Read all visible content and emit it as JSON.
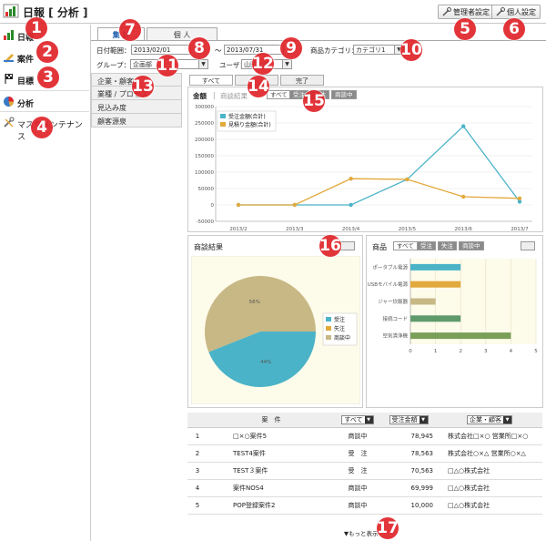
{
  "header": {
    "title": "日報 [ 分析 ]",
    "admin_label": "管理者設定",
    "personal_label": "個人設定"
  },
  "sidebar": {
    "items": [
      {
        "label": "日報"
      },
      {
        "label": "案件"
      },
      {
        "label": "目標"
      },
      {
        "label": "分析"
      },
      {
        "label": "マスタメンテナンス"
      }
    ]
  },
  "tabs": {
    "summary": "集 計",
    "personal": "個 人"
  },
  "filters": {
    "date_label": "日付範囲：",
    "date_from": "2013/02/01",
    "date_sep": "～",
    "date_to": "2013/07/31",
    "category_label": "商品カテゴリ：",
    "category_value": "カテゴリ1",
    "group_label": "グループ：",
    "group_value": "企画部",
    "user_label": "ユーザ：",
    "user_value": "山田太郎"
  },
  "left_menu": {
    "items": [
      {
        "label": "企業・顧客"
      },
      {
        "label": "業種 / プロセス"
      },
      {
        "label": "見込み度"
      },
      {
        "label": "顧客源泉"
      }
    ]
  },
  "status_tabs": {
    "items": [
      {
        "label": "すべて"
      },
      {
        "label": ""
      },
      {
        "label": "完了"
      }
    ]
  },
  "metric_tabs": {
    "amount": "金額",
    "sep": "|",
    "count": "商談結果",
    "mini": [
      "すべて",
      "受注",
      "失注",
      "商談中"
    ]
  },
  "line_chart": {
    "type": "line",
    "categories": [
      "2013/2",
      "2013/3",
      "2013/4",
      "2013/5",
      "2013/6",
      "2013/7"
    ],
    "ylim": [
      -50000,
      300000
    ],
    "yticks": [
      "300000",
      "250000",
      "200000",
      "150000",
      "100000",
      "50000",
      "0",
      "-50000"
    ],
    "series": [
      {
        "name": "受注金額(合計)",
        "color": "#4bb3c8",
        "values": [
          0,
          0,
          0,
          78000,
          240000,
          10000
        ]
      },
      {
        "name": "見積り金額(合計)",
        "color": "#e2a93c",
        "values": [
          0,
          0,
          80000,
          78000,
          25000,
          20000
        ]
      }
    ]
  },
  "pie_chart": {
    "type": "pie",
    "title": "商談結果",
    "slices": [
      {
        "name": "受注",
        "value": 44,
        "color": "#4bb3c8",
        "label": "44%"
      },
      {
        "name": "失注",
        "value": 0,
        "color": "#e2a93c",
        "label": ""
      },
      {
        "name": "商談中",
        "value": 56,
        "color": "#c7b885",
        "label": "56%"
      }
    ]
  },
  "bar_chart": {
    "type": "bar",
    "title": "商品",
    "tabs": [
      "すべて",
      "受注",
      "失注",
      "商談中"
    ],
    "categories": [
      "ポータブル電源",
      "USBモバイル電源",
      "ジャー炊飯器",
      "接続コード",
      "空気清浄機"
    ],
    "values": [
      2,
      2,
      1,
      2,
      4
    ],
    "colors": [
      "#4bb3c8",
      "#e2a93c",
      "#c7b885",
      "#5f9a6b",
      "#7a9f58"
    ],
    "xlim": [
      0,
      5
    ],
    "xticks": [
      "0",
      "1",
      "2",
      "3",
      "4",
      "5"
    ]
  },
  "table": {
    "headers": {
      "case": "案　件",
      "status": "すべて",
      "amount": "受注金額",
      "client": "企業・顧客"
    },
    "rows": [
      {
        "no": "1",
        "case": "□×○案件5",
        "status": "商談中",
        "amount": "78,945",
        "client": "株式会社□×○ 営業所□×○"
      },
      {
        "no": "2",
        "case": "TEST4案件",
        "status": "受　注",
        "amount": "78,563",
        "client": "株式会社○×△ 営業所○×△"
      },
      {
        "no": "3",
        "case": "TEST３案件",
        "status": "受　注",
        "amount": "70,563",
        "client": "□△○株式会社"
      },
      {
        "no": "4",
        "case": "案件NOS4",
        "status": "商談中",
        "amount": "69,999",
        "client": "□△○株式会社"
      },
      {
        "no": "5",
        "case": "POP登録案件2",
        "status": "商談中",
        "amount": "10,000",
        "client": "□△○株式会社"
      }
    ],
    "more": "▼もっと表示"
  },
  "badges": [
    "1",
    "2",
    "3",
    "4",
    "5",
    "6",
    "7",
    "8",
    "9",
    "10",
    "11",
    "12",
    "13",
    "14",
    "15",
    "16",
    "17"
  ]
}
